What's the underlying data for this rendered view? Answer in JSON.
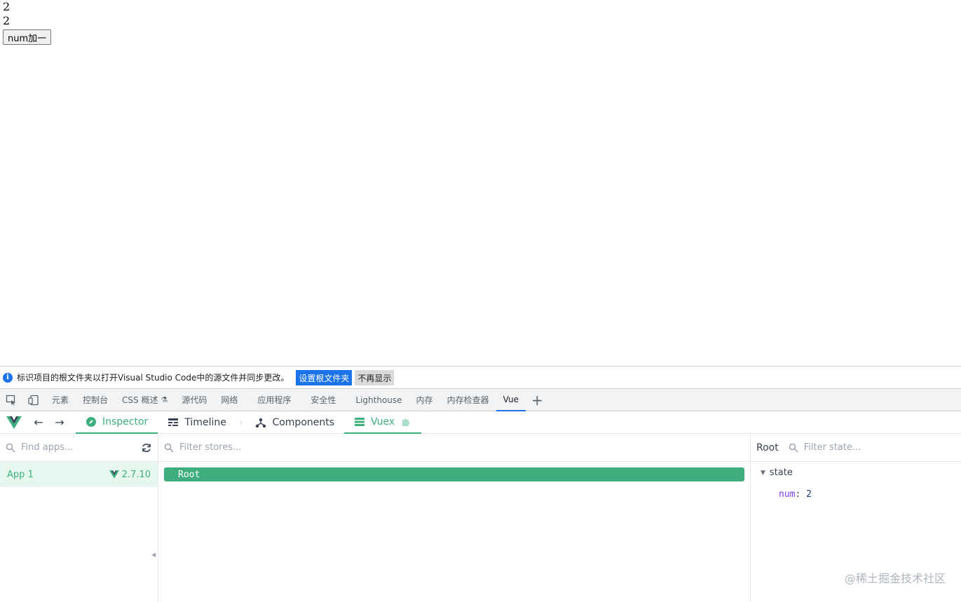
{
  "page": {
    "line1": "2",
    "line2": "2",
    "button": "num加一"
  },
  "infobar": {
    "text": "标识项目的根文件夹以打开Visual Studio Code中的源文件并同步更改。",
    "primary_btn": "设置根文件夹",
    "secondary_btn": "不再显示"
  },
  "devtools_tabs": [
    "元素",
    "控制台",
    "CSS 概述",
    "源代码",
    "网络",
    "应用程序",
    "安全性",
    "Lighthouse",
    "内存",
    "内存检查器",
    "Vue"
  ],
  "vue_tabs": {
    "inspector": "Inspector",
    "timeline": "Timeline",
    "components": "Components",
    "vuex": "Vuex"
  },
  "apps": {
    "placeholder": "Find apps...",
    "app_name": "App 1",
    "version": "2.7.10"
  },
  "stores": {
    "placeholder": "Filter stores...",
    "root": "Root"
  },
  "state": {
    "title": "Root",
    "placeholder": "Filter state...",
    "section": "state",
    "key": "num",
    "value": "2"
  },
  "watermark": "@稀土掘金技术社区",
  "colors": {
    "vue_green": "#3eaf7c",
    "chrome_blue": "#1a73e8"
  }
}
